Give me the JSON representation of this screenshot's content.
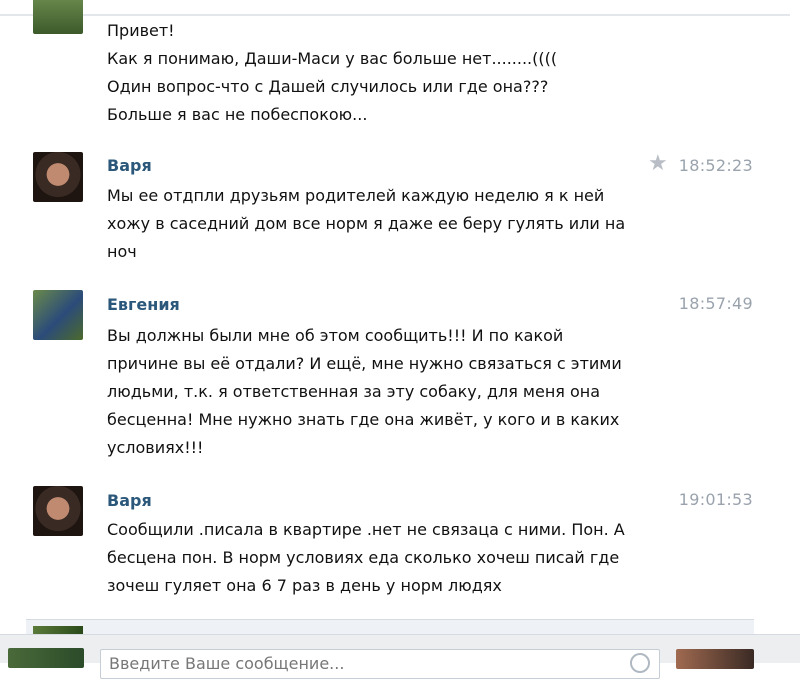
{
  "messages": [
    {
      "author": "",
      "time": "",
      "lines": [
        "Привет!",
        "Как я понимаю, Даши-Маси у вас больше нет........((((",
        "Один вопрос-что с Дашей случилось или где она???",
        "Больше я вас не побеспокою..."
      ]
    },
    {
      "author": "Варя",
      "time": "18:52:23",
      "lines": [
        "Мы ее отдпли друзьям родителей каждую неделю я к ней",
        "хожу в саседний дом все норм я даже ее беру гулять или на",
        "ноч"
      ]
    },
    {
      "author": "Евгения",
      "time": "18:57:49",
      "lines": [
        "Вы должны были мне об этом сообщить!!! И по какой",
        "причине вы её отдали? И ещё, мне нужно связаться с этими",
        "людьми, т.к. я ответственная за эту собаку, для меня она",
        "бесценна! Мне нужно знать где она живёт, у кого и в каких",
        "условиях!!!"
      ]
    },
    {
      "author": "Варя",
      "time": "19:01:53",
      "lines": [
        "Сообщили .писала в квартире .нет не связаца с ними. Пон. А",
        "бесцена пон. В норм условиях еда сколько хочеш писай где",
        "зочеш гуляет она 6 7 раз в день у норм людях"
      ]
    }
  ],
  "composer": {
    "placeholder": "Введите Ваше сообщение..."
  },
  "icons": {
    "favorite": "star-icon",
    "attach": "attach-icon"
  }
}
